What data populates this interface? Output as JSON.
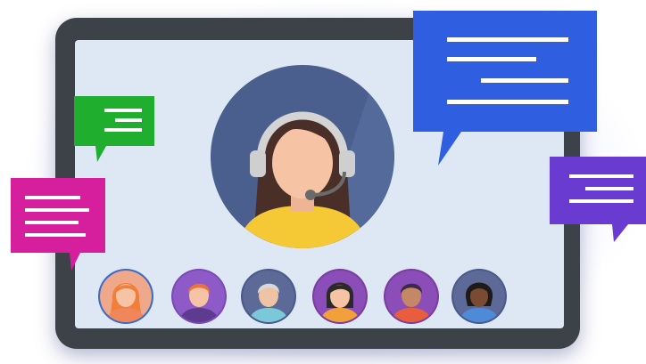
{
  "scene": {
    "host": {
      "name": "agent-with-headset"
    },
    "participants": [
      {
        "id": "p1",
        "ring": "#3d6cc7",
        "bg": "#f0a88b",
        "hair": "#f07f3c",
        "skin": "#f6c4a4",
        "shirt": "#f0865a"
      },
      {
        "id": "p2",
        "ring": "#7a4ab8",
        "bg": "#8e5ac8",
        "hair": "#e8743a",
        "skin": "#f6c4a4",
        "shirt": "#5d3b8e"
      },
      {
        "id": "p3",
        "ring": "#4a5a8a",
        "bg": "#5d6a98",
        "hair": "#d8d8d8",
        "skin": "#f0c3a4",
        "shirt": "#7bc8d8"
      },
      {
        "id": "p4",
        "ring": "#7a3da0",
        "bg": "#8b4db8",
        "hair": "#2a2a2a",
        "skin": "#f6c4a4",
        "shirt": "#f2a03a"
      },
      {
        "id": "p5",
        "ring": "#7a3da0",
        "bg": "#8b4db8",
        "hair": "#3a2a4a",
        "skin": "#c48866",
        "shirt": "#e85e3c"
      },
      {
        "id": "p6",
        "ring": "#4a5a8a",
        "bg": "#5d6a98",
        "hair": "#1f1a1a",
        "skin": "#7a4a32",
        "shirt": "#4d8ad8"
      }
    ],
    "bubbles": [
      {
        "id": "green",
        "color": "#1fae2e"
      },
      {
        "id": "magenta",
        "color": "#d61f9c"
      },
      {
        "id": "blue",
        "color": "#2f5fe0"
      },
      {
        "id": "purple",
        "color": "#6a3bd0"
      }
    ]
  },
  "colors": {
    "tablet_frame": "#3d4148",
    "screen": "#dde8f4",
    "host_circle": "#4b5f8f",
    "host_shirt": "#f5c936",
    "host_hair": "#4a2f28",
    "host_skin": "#f6c4a4",
    "headset": "#d4d4d4"
  }
}
